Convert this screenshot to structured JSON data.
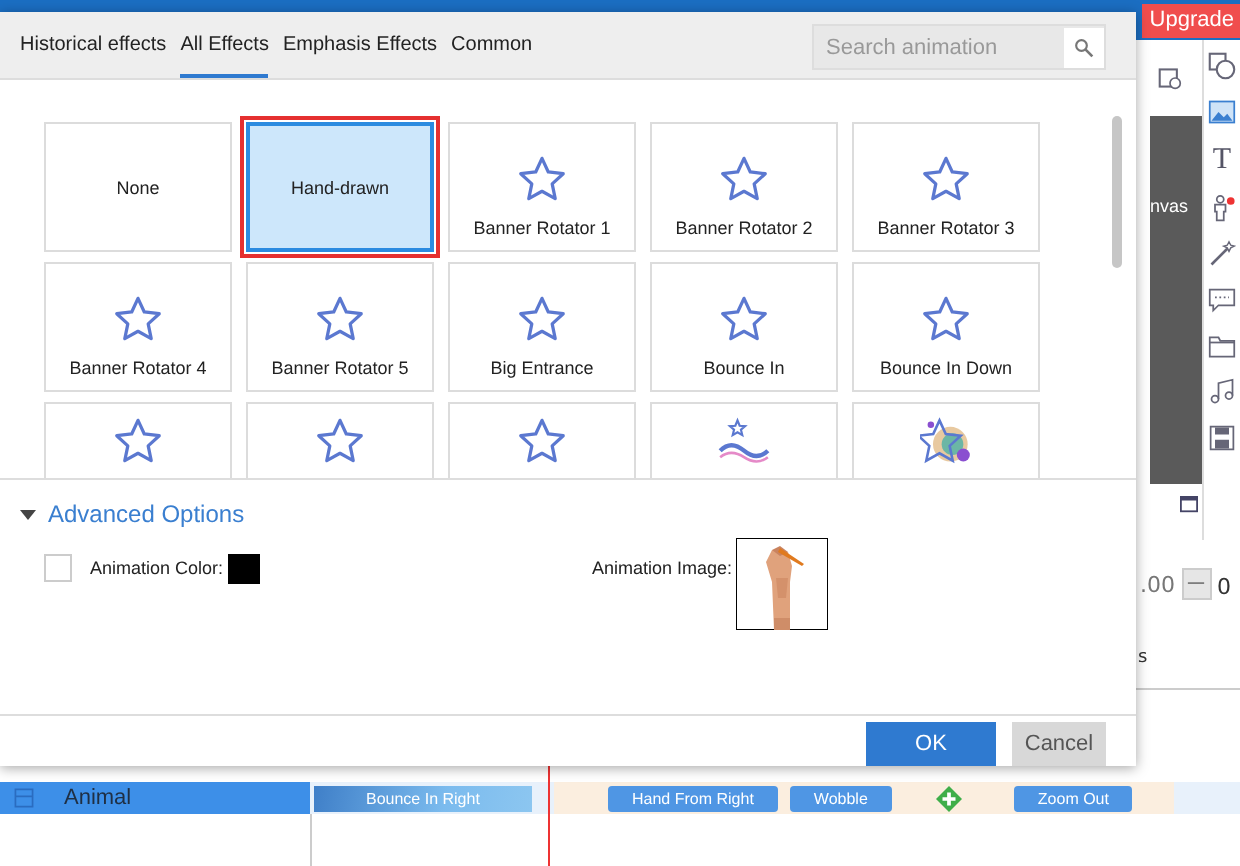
{
  "app": {
    "upgrade_badge": "Upgrade",
    "canvas_label": "nvas",
    "tool_text": "T",
    "duration_value": ".00",
    "stepper_minus": "—",
    "stepper_value": "0",
    "ruler_label": "s"
  },
  "dialog": {
    "tabs": [
      {
        "label": "Historical effects",
        "selected": false
      },
      {
        "label": "All Effects",
        "selected": true
      },
      {
        "label": "Emphasis Effects",
        "selected": false
      },
      {
        "label": "Common",
        "selected": false
      }
    ],
    "search": {
      "placeholder": "Search animation"
    },
    "effects": [
      {
        "kind": "plain",
        "label": "None",
        "selected": false
      },
      {
        "kind": "plain",
        "label": "Hand-drawn",
        "selected": true
      },
      {
        "kind": "star",
        "label": "Banner Rotator 1",
        "selected": false
      },
      {
        "kind": "star",
        "label": "Banner Rotator 2",
        "selected": false
      },
      {
        "kind": "star",
        "label": "Banner Rotator 3",
        "selected": false
      },
      {
        "kind": "star",
        "label": "Banner Rotator 4",
        "selected": false
      },
      {
        "kind": "star",
        "label": "Banner Rotator 5",
        "selected": false
      },
      {
        "kind": "star",
        "label": "Big Entrance",
        "selected": false
      },
      {
        "kind": "star",
        "label": "Bounce In",
        "selected": false
      },
      {
        "kind": "star",
        "label": "Bounce In Down",
        "selected": false
      },
      {
        "kind": "star",
        "selected": false
      },
      {
        "kind": "star",
        "selected": false
      },
      {
        "kind": "star",
        "selected": false
      },
      {
        "kind": "logo",
        "selected": false
      },
      {
        "kind": "bubbles",
        "selected": false
      }
    ],
    "advanced": {
      "title": "Advanced Options",
      "expanded": true,
      "color_option": {
        "label": "Animation Color:",
        "checked": false,
        "color": "#000000"
      },
      "image_option": {
        "label": "Animation Image:",
        "kind": "picture"
      }
    },
    "buttons": [
      {
        "label": "OK",
        "kind": "primary"
      },
      {
        "label": "Cancel",
        "kind": "secondary"
      }
    ]
  },
  "timeline": {
    "layer": "Animal",
    "clips": [
      {
        "label": "Bounce In Right",
        "selected": true
      },
      {
        "label": "Hand From Right",
        "selected": false
      },
      {
        "label": "Wobble",
        "selected": false
      },
      {
        "kind": "add"
      },
      {
        "label": "Zoom Out",
        "selected": false
      }
    ]
  }
}
